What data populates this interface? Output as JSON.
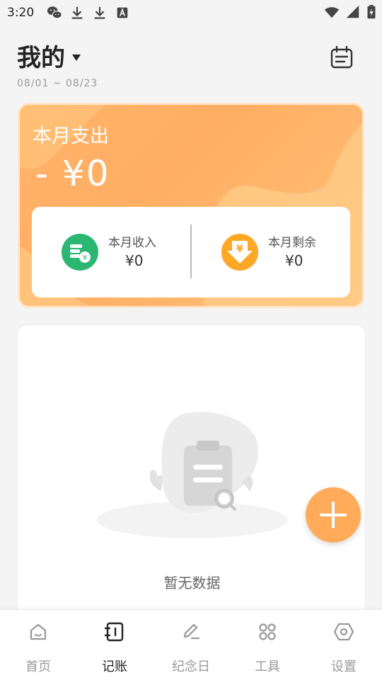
{
  "status_bar": {
    "time": "3:20",
    "left_icons": [
      "wechat-icon",
      "download-icon",
      "download-icon",
      "a-icon"
    ],
    "right_icons": [
      "wifi-icon",
      "signal-icon",
      "battery-icon"
    ]
  },
  "header": {
    "title": "我的",
    "date_range": "08/01 ~ 08/23",
    "calendar_icon": "calendar-icon",
    "dropdown_icon": "caret-down-icon"
  },
  "summary": {
    "expense_label": "本月支出",
    "expense_value": "- ¥0",
    "income_label": "本月收入",
    "income_value": "¥0",
    "remain_label": "本月剩余",
    "remain_value": "¥0",
    "income_icon_color": "#2bb673",
    "remain_icon_color": "#ffa726"
  },
  "content": {
    "empty_text": "暂无数据"
  },
  "fab": {
    "icon": "plus-icon",
    "color": "#ffab5a"
  },
  "bottom_nav": {
    "items": [
      {
        "label": "首页",
        "icon": "home-icon",
        "active": false
      },
      {
        "label": "记账",
        "icon": "notebook-icon",
        "active": true
      },
      {
        "label": "纪念日",
        "icon": "pen-icon",
        "active": false
      },
      {
        "label": "工具",
        "icon": "apps-icon",
        "active": false
      },
      {
        "label": "设置",
        "icon": "settings-icon",
        "active": false
      }
    ]
  },
  "colors": {
    "accent": "#ffab5a",
    "card_gradient_start": "#ffb46a",
    "card_gradient_end": "#ffc27a"
  }
}
